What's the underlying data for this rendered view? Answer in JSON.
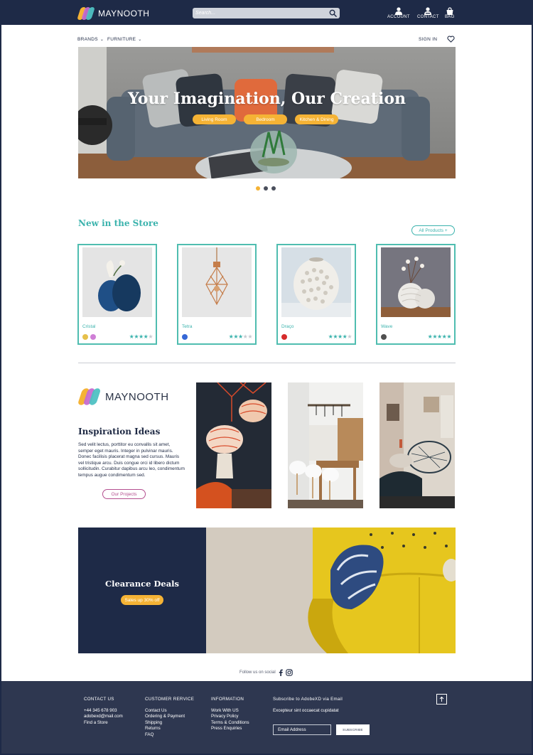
{
  "header": {
    "brand": "MAYNOOTH",
    "search_placeholder": "Search...",
    "actions": [
      {
        "label": "ACCOUNT",
        "icon": "user-icon"
      },
      {
        "label": "CONTACT",
        "icon": "contact-icon"
      },
      {
        "label": "BAG",
        "icon": "bag-icon"
      }
    ]
  },
  "nav": {
    "brands": "BRANDS",
    "furniture": "FURNITURE",
    "sign_in": "SIGN IN",
    "wishlist_icon": "heart-icon"
  },
  "hero": {
    "title": "Your Imagination, Our Creation",
    "pills": [
      "Living Room",
      "Bedroom",
      "Kitchen & Dining"
    ],
    "slides": 3,
    "active_slide": 1
  },
  "new_in_store": {
    "title": "New in the Store",
    "all_products": "All Products +",
    "products": [
      {
        "name": "Cristal",
        "colors": [
          "#e6c04a",
          "#cf7fd6"
        ],
        "rating": 4
      },
      {
        "name": "Tetra",
        "colors": [
          "#3567d6"
        ],
        "rating": 3
      },
      {
        "name": "Draço",
        "colors": [
          "#d62b2b"
        ],
        "rating": 4
      },
      {
        "name": "Wave",
        "colors": [
          "#505050"
        ],
        "rating": 5
      }
    ]
  },
  "inspiration": {
    "brand": "MAYNOOTH",
    "title": "Inspiration Ideas",
    "body": "Sed velit lectus, porttitor eu convallis sit amet, semper eget mauris. Integer in pulvinar mauris. Donec facilisis placerat magna sed cursus. Mauris vel tristique arcu. Duis congue orci id libero dictum sollicitudin. Curabitur dapibus arcu leo, condimentum tempus augue condimentum sed.",
    "button": "Our Projects"
  },
  "clearance": {
    "title": "Clearance Deals",
    "badge": "Sales up 30% off"
  },
  "social": {
    "label": "Follow us on social"
  },
  "footer": {
    "contact": {
      "heading": "CONTACT US",
      "lines": [
        "+44 345 678 903",
        "adobexd@mail.com",
        "Find a Store"
      ]
    },
    "service": {
      "heading": "CUSTOMER RERVICE",
      "lines": [
        "Contact Us",
        "Ordering & Payment",
        "Shipping",
        "Returns",
        "FAQ"
      ]
    },
    "information": {
      "heading": "INFORMATION",
      "lines": [
        "Work With US",
        "Privacy Policy",
        "Terms & Conditions",
        "Press Enquiries"
      ]
    },
    "subscribe": {
      "heading": "Subscribe to AdobeXD via Email",
      "text": "Excepteur sint occaecat cupidatat",
      "email_placeholder": "Email Address",
      "button": "SUBSCRIBE"
    }
  },
  "colors": {
    "navy": "#1e2a47",
    "teal": "#3bb3ad",
    "amber": "#f5b335",
    "magenta": "#b44f8f",
    "footer": "#2e3750"
  }
}
